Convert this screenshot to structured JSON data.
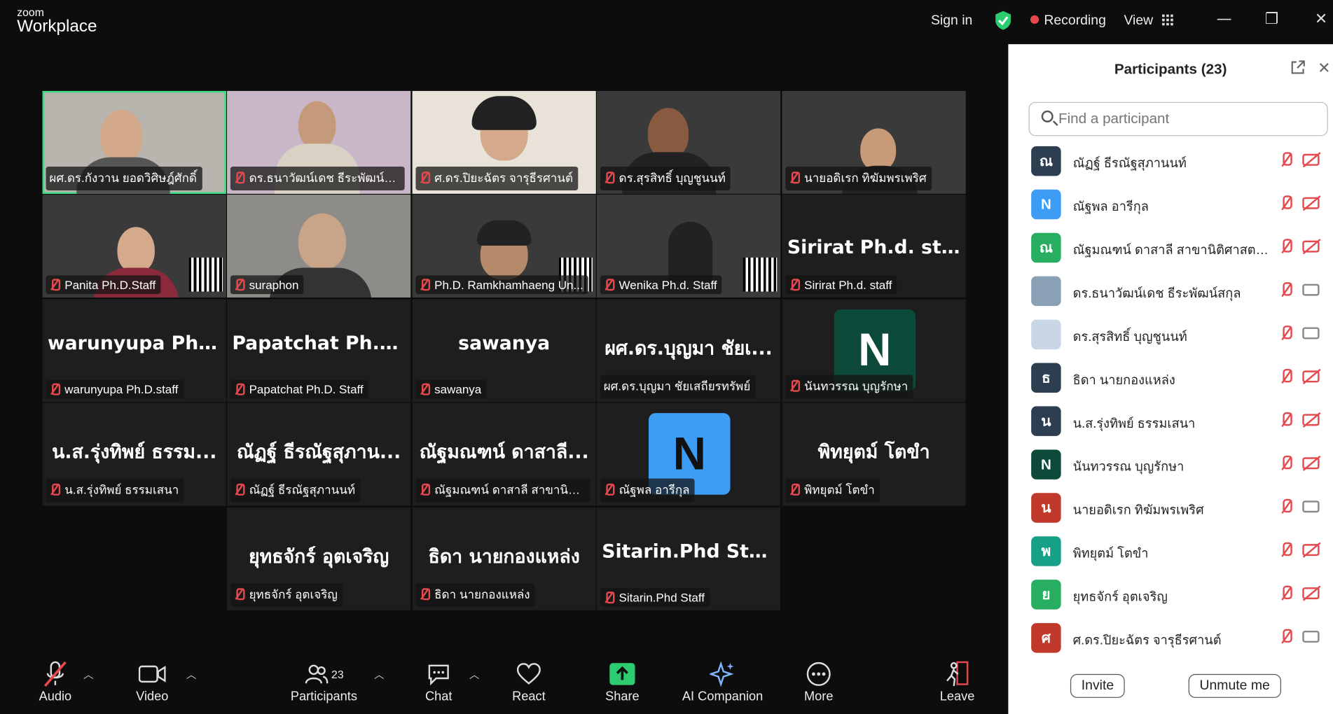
{
  "app": {
    "logo_top": "zoom",
    "logo_bottom": "Workplace"
  },
  "titlebar": {
    "sign_in": "Sign in",
    "recording": "Recording",
    "view": "View"
  },
  "tiles": [
    {
      "label": "ผศ.ดร.กังวาน ยอดวิศิษฎ์ศักดิ์",
      "muted": false
    },
    {
      "label": "ดร.ธนาวัฒน์เดช ธีระพัฒน์สกุล",
      "muted": true
    },
    {
      "label": "ศ.ดร.ปิยะฉัตร จารุธีรศานต์",
      "muted": true
    },
    {
      "label": "ดร.สุรสิทธิ์ บุญชูนนท์",
      "muted": true
    },
    {
      "label": "นายอดิเรก ทิฆัมพรเพริศ",
      "muted": true
    },
    {
      "label": "Panita Ph.D.Staff",
      "muted": true
    },
    {
      "label": "suraphon",
      "muted": true
    },
    {
      "label": "Ph.D. Ramkhamhaeng Un...",
      "muted": true
    },
    {
      "label": "Wenika Ph.d. Staff",
      "muted": true
    },
    {
      "big": "Sirirat Ph.d. staff",
      "label": "Sirirat Ph.d. staff",
      "muted": true
    },
    {
      "big": "warunyupa  Ph....",
      "label": "warunyupa Ph.D.staff",
      "muted": true
    },
    {
      "big": "Papatchat  Ph.D....",
      "label": "Papatchat Ph.D. Staff",
      "muted": true
    },
    {
      "big": "sawanya",
      "label": "sawanya",
      "muted": true
    },
    {
      "big": "ผศ.ดร.บุญมา ชัยเ...",
      "label": "ผศ.ดร.บุญมา ชัยเสถียรทรัพย์",
      "muted": false
    },
    {
      "avatar": "N",
      "label": "นันทวรรณ บุญรักษา",
      "muted": true
    },
    {
      "big": "น.ส.รุ่งทิพย์ ธรรม...",
      "label": "น.ส.รุ่งทิพย์ ธรรมเสนา",
      "muted": true
    },
    {
      "big": "ณัฏฐ์ ธีรณัฐสุภาน...",
      "label": "ณัฏฐ์ ธีรณัฐสุภานนท์",
      "muted": true
    },
    {
      "big": "ณัฐมณฑน์ ดาสาลี...",
      "label": "ณัฐมณฑน์ ดาสาลี สาขานิติศ...",
      "muted": true
    },
    {
      "avatar": "N",
      "label": "ณัฐพล อารีกุล",
      "muted": true
    },
    {
      "big": "พิทยุตม์ โตขำ",
      "label": "พิทยุตม์ โตขำ",
      "muted": true
    },
    {
      "big": "ยุทธจักร์ อุตเจริญ",
      "label": "ยุทธจักร์ อุตเจริญ",
      "muted": true
    },
    {
      "big": "ธิดา นายกองแหล่ง",
      "label": "ธิดา นายกองแหล่ง",
      "muted": true
    },
    {
      "big": "Sitarin.Phd Staff",
      "label": "Sitarin.Phd Staff",
      "muted": true
    }
  ],
  "toolbar": {
    "audio": "Audio",
    "video": "Video",
    "participants": "Participants",
    "participants_count": "23",
    "chat": "Chat",
    "react": "React",
    "share": "Share",
    "ai": "AI Companion",
    "more": "More",
    "leave": "Leave"
  },
  "panel": {
    "title": "Participants (23)",
    "search_placeholder": "Find a participant",
    "invite": "Invite",
    "unmute": "Unmute me",
    "participants": [
      {
        "initial": "ณ",
        "color": "#2d3e50",
        "name": "ณัฏฐ์ ธีรณัฐสุภานนท์",
        "cam_off": true
      },
      {
        "initial": "N",
        "color": "#3d9df5",
        "name": "ณัฐพล อารีกุล",
        "cam_off": true
      },
      {
        "initial": "ณ",
        "color": "#27ae60",
        "name": "ณัฐมณฑน์ ดาสาลี สาขานิติศาสตร์ด...",
        "cam_off": true
      },
      {
        "initial": "",
        "color": "#8aa0b5",
        "name": "ดร.ธนาวัฒน์เดช ธีระพัฒน์สกุล",
        "cam_off": false
      },
      {
        "initial": "",
        "color": "#c9d6e6",
        "name": "ดร.สุรสิทธิ์ บุญชูนนท์",
        "cam_off": false
      },
      {
        "initial": "ธ",
        "color": "#2d3e50",
        "name": "ธิดา นายกองแหล่ง",
        "cam_off": true
      },
      {
        "initial": "น",
        "color": "#2d3e50",
        "name": "น.ส.รุ่งทิพย์ ธรรมเสนา",
        "cam_off": true
      },
      {
        "initial": "N",
        "color": "#0d4a3a",
        "name": "นันทวรรณ บุญรักษา",
        "cam_off": true
      },
      {
        "initial": "น",
        "color": "#c0392b",
        "name": "นายอดิเรก ทิฆัมพรเพริศ",
        "cam_off": false
      },
      {
        "initial": "พ",
        "color": "#16a085",
        "name": "พิทยุตม์ โตขำ",
        "cam_off": true
      },
      {
        "initial": "ย",
        "color": "#27ae60",
        "name": "ยุทธจักร์ อุตเจริญ",
        "cam_off": true
      },
      {
        "initial": "ศ",
        "color": "#c0392b",
        "name": "ศ.ดร.ปิยะฉัตร จารุธีรศานต์",
        "cam_off": false
      }
    ]
  }
}
